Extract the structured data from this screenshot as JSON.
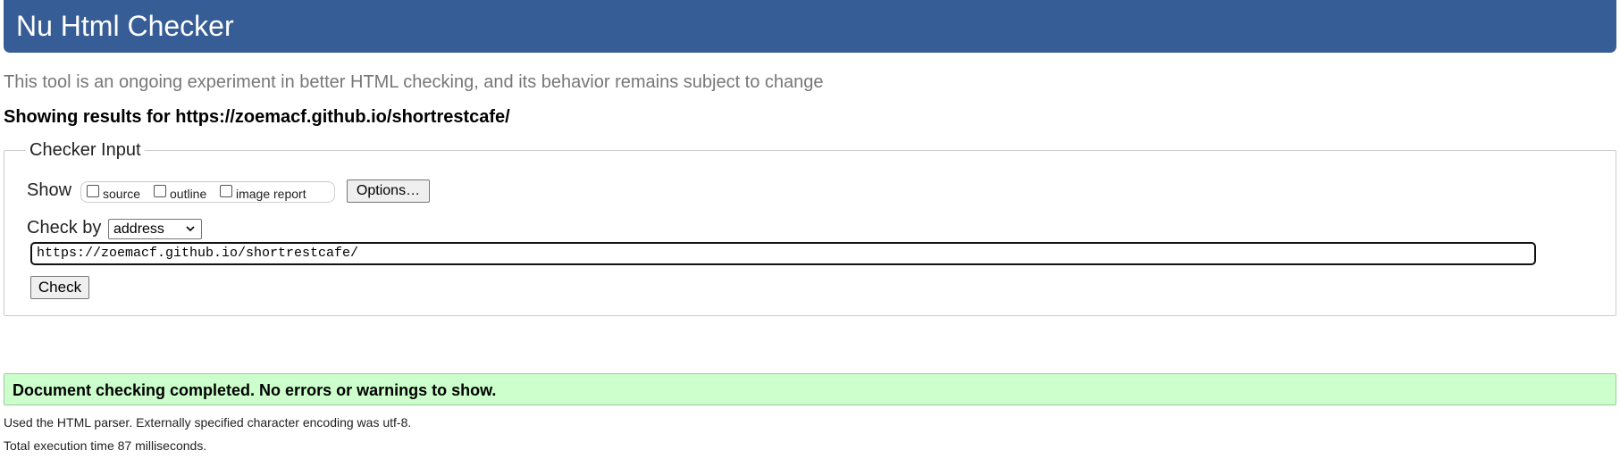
{
  "header": {
    "title": "Nu Html Checker"
  },
  "tagline": "This tool is an ongoing experiment in better HTML checking, and its behavior remains subject to change",
  "results_for": "Showing results for https://zoemacf.github.io/shortrestcafe/",
  "checker_input": {
    "legend": "Checker Input",
    "show_label": "Show",
    "show_options": [
      {
        "label": "source",
        "checked": false
      },
      {
        "label": "outline",
        "checked": false
      },
      {
        "label": "image report",
        "checked": false
      }
    ],
    "options_button": "Options…",
    "check_by_label": "Check by",
    "check_by_selected": "address",
    "url_value": "https://zoemacf.github.io/shortrestcafe/",
    "check_button": "Check"
  },
  "result": {
    "message": "Document checking completed. No errors or warnings to show.",
    "parser_info": "Used the HTML parser. Externally specified character encoding was utf-8.",
    "execution_time": "Total execution time 87 milliseconds."
  },
  "colors": {
    "header_bg": "#365D95",
    "success_bg": "#CCFFCC",
    "tagline": "#777777"
  },
  "icons": {
    "select_arrow": "chevron-down-icon"
  }
}
